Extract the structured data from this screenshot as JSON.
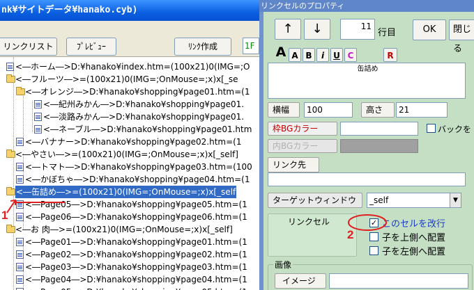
{
  "left_window": {
    "title": "nk¥サイトデータ¥hanako.cyb)",
    "toolbar": {
      "linklist": "リンクリスト",
      "preview": "ﾌﾟﾚﾋﾞｭｰ",
      "create": "ﾘﾝｸ作成",
      "page_combo": "1F"
    },
    "tree": [
      {
        "icon": "page",
        "depth": 0,
        "text": "<―ホーム―>D:¥hanako¥index.htm=(100x21)0(IMG=;O"
      },
      {
        "icon": "folder",
        "depth": 0,
        "text": "<―フルーツ―>=(100x21)0(IMG=;OnMouse=;x)x[_se"
      },
      {
        "icon": "folder",
        "depth": 1,
        "text": "<―オレンジ―>D:¥hanako¥shopping¥page01.htm=(1"
      },
      {
        "icon": "page",
        "depth": 2,
        "text": "<―紀州みかん―>D:¥hanako¥shopping¥page01."
      },
      {
        "icon": "page",
        "depth": 2,
        "text": "<―淡路みかん―>D:¥hanako¥shopping¥page01."
      },
      {
        "icon": "page",
        "depth": 2,
        "text": "<―ネーブル―>D:¥hanako¥shopping¥page01.htm"
      },
      {
        "icon": "page",
        "depth": 1,
        "text": "<―バナナー>D:¥hanako¥shopping¥page02.htm=(1"
      },
      {
        "icon": "folder",
        "depth": 0,
        "text": "<―やさい―>=(100x21)0(IMG=;OnMouse=;x)x[_self]"
      },
      {
        "icon": "page",
        "depth": 1,
        "text": "<―トマト―>D:¥hanako¥shopping¥page03.htm=(100"
      },
      {
        "icon": "page",
        "depth": 1,
        "text": "<―かぼちゃ―>D:¥hanako¥shopping¥page04.htm=(1"
      },
      {
        "icon": "folder",
        "depth": 0,
        "text": "<―缶詰め―>=(100x21)0(IMG=;OnMouse=;x)x[_self",
        "selected": true
      },
      {
        "icon": "page",
        "depth": 1,
        "text": "<―Page05―>D:¥hanako¥shopping¥page05.htm=(1"
      },
      {
        "icon": "page",
        "depth": 1,
        "text": "<―Page06―>D:¥hanako¥shopping¥page06.htm=(1"
      },
      {
        "icon": "folder",
        "depth": 0,
        "text": "<―お 肉―>=(100x21)0(IMG=;OnMouse=;x)x[_self]"
      },
      {
        "icon": "page",
        "depth": 1,
        "text": "<―Page01―>D:¥hanako¥shopping¥page01.htm=(1"
      },
      {
        "icon": "page",
        "depth": 1,
        "text": "<―Page02―>D:¥hanako¥shopping¥page02.htm=(1"
      },
      {
        "icon": "page",
        "depth": 1,
        "text": "<―Page03―>D:¥hanako¥shopping¥page03.htm=(1"
      },
      {
        "icon": "page",
        "depth": 1,
        "text": "<―Page04―>D:¥hanako¥shopping¥page04.htm=(1"
      },
      {
        "icon": "page",
        "depth": 1,
        "text": "<―Page05―>D:¥hanako¥shopping¥page05.htm=(1"
      }
    ]
  },
  "annotations": {
    "one": "1",
    "two": "2",
    "color": "#e02020"
  },
  "dialog": {
    "title": "リンクセルのプロパティ",
    "up_arrow": "↑",
    "down_arrow": "↓",
    "row_value": "11",
    "row_label": "行目",
    "ok": "OK",
    "close": "閉じる",
    "format_buttons": [
      "A",
      "A",
      "B",
      "i",
      "U",
      "C",
      "R"
    ],
    "cell_text": "缶詰め",
    "width_label": "横幅",
    "width_value": "100",
    "height_label": "高さ",
    "height_value": "21",
    "frame_bg": "枠BGカラー",
    "inner_bg": "内BGカラー",
    "back_check": "バックを",
    "link_dest": "リンク先",
    "target_label": "ターゲットウィンドウ",
    "target_value": "_self",
    "linkcell_label": "リンクセル",
    "newline_check": "このセルを改行",
    "top_check": "子を上側へ配置",
    "left_check": "子を左側へ配置",
    "image_group": "画像",
    "image_button": "イメージ",
    "colors": {
      "dialog_bg": "#c4dfc4",
      "selection": "#316ac5",
      "titlebar": "#0a5ee0"
    }
  }
}
